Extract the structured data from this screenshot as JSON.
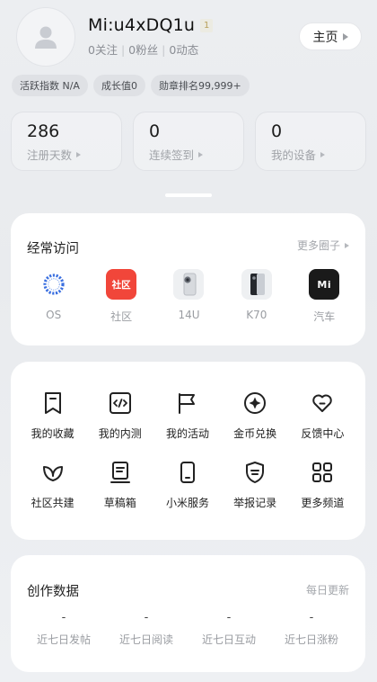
{
  "profile": {
    "username": "Mi:u4xDQ1u",
    "level": "1",
    "stats": [
      "0关注",
      "0粉丝",
      "0动态"
    ],
    "home_button": "主页"
  },
  "chips": [
    "活跃指数 N/A",
    "成长值0",
    "勋章排名99,999+"
  ],
  "stat_cards": [
    {
      "value": "286",
      "label": "注册天数"
    },
    {
      "value": "0",
      "label": "连续签到"
    },
    {
      "value": "0",
      "label": "我的设备"
    }
  ],
  "frequent": {
    "title": "经常访问",
    "more": "更多圈子",
    "items": [
      {
        "label": "OS",
        "icon": "os-ring-icon"
      },
      {
        "label": "社区",
        "icon": "community-icon",
        "text": "社区"
      },
      {
        "label": "14U",
        "icon": "phone-14u-icon"
      },
      {
        "label": "K70",
        "icon": "phone-k70-icon"
      },
      {
        "label": "汽车",
        "icon": "car-logo-icon",
        "text": "Mi"
      }
    ]
  },
  "features": [
    {
      "label": "我的收藏",
      "icon": "bookmark-icon"
    },
    {
      "label": "我的内测",
      "icon": "code-icon"
    },
    {
      "label": "我的活动",
      "icon": "flag-icon"
    },
    {
      "label": "金币兑换",
      "icon": "coin-icon"
    },
    {
      "label": "反馈中心",
      "icon": "heart-icon"
    },
    {
      "label": "社区共建",
      "icon": "leaf-icon"
    },
    {
      "label": "草稿箱",
      "icon": "draft-icon"
    },
    {
      "label": "小米服务",
      "icon": "device-icon"
    },
    {
      "label": "举报记录",
      "icon": "shield-icon"
    },
    {
      "label": "更多频道",
      "icon": "grid-icon"
    }
  ],
  "creation": {
    "title": "创作数据",
    "more": "每日更新",
    "items": [
      {
        "value": "-",
        "label": "近七日发帖"
      },
      {
        "value": "-",
        "label": "近七日阅读"
      },
      {
        "value": "-",
        "label": "近七日互动"
      },
      {
        "value": "-",
        "label": "近七日涨粉"
      }
    ]
  },
  "colors": {
    "accent_red": "#f1463a",
    "os_blue": "#3a6fe0",
    "text_gray": "#9a9da2"
  }
}
